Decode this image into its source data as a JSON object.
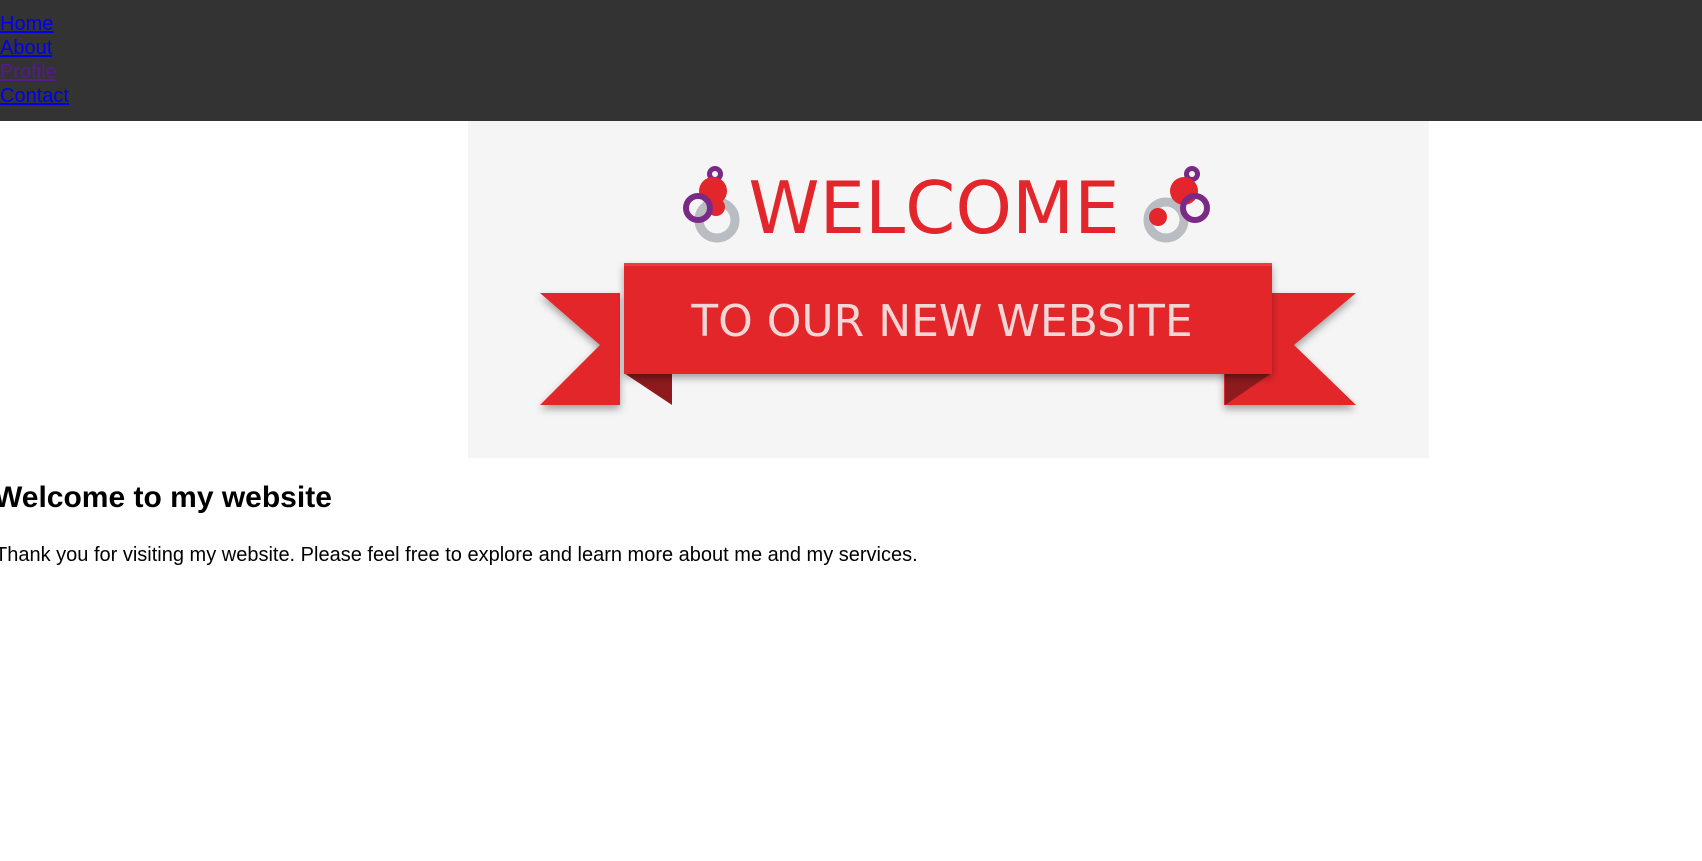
{
  "nav": {
    "items": [
      {
        "label": "Home"
      },
      {
        "label": "About"
      },
      {
        "label": "Profile"
      },
      {
        "label": "Contact"
      }
    ]
  },
  "banner": {
    "headline": "WELCOME",
    "ribbon_text": "TO OUR NEW WEBSITE",
    "colors": {
      "red": "#e3262b",
      "purple": "#7a2a86",
      "grey": "#b9bcc1",
      "background": "#f5f5f5"
    }
  },
  "main": {
    "heading": "Welcome to my website",
    "paragraph": "Thank you for visiting my website. Please feel free to explore and learn more about me and my services."
  },
  "colors": {
    "navbar_bg": "#333333",
    "link": "#0000ee",
    "visited_link": "#551a8b"
  }
}
